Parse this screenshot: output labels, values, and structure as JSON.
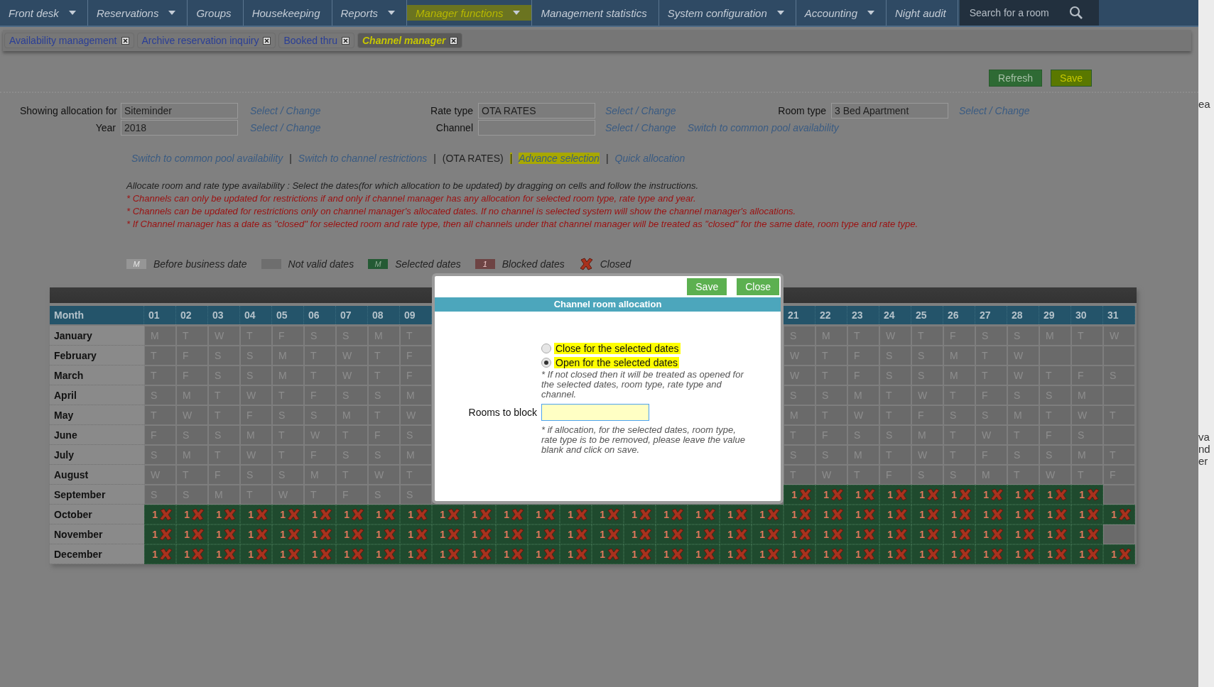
{
  "nav": {
    "items": [
      {
        "label": "Front desk",
        "dropdown": true,
        "highlighted": false
      },
      {
        "label": "Reservations",
        "dropdown": true,
        "highlighted": false
      },
      {
        "label": "Groups",
        "dropdown": false,
        "highlighted": false
      },
      {
        "label": "Housekeeping",
        "dropdown": false,
        "highlighted": false
      },
      {
        "label": "Reports",
        "dropdown": true,
        "highlighted": false
      },
      {
        "label": "Manager functions",
        "dropdown": true,
        "highlighted": true
      },
      {
        "label": "Management statistics",
        "dropdown": false,
        "highlighted": false
      },
      {
        "label": "System configuration",
        "dropdown": true,
        "highlighted": false
      },
      {
        "label": "Accounting",
        "dropdown": true,
        "highlighted": false
      },
      {
        "label": "Night audit",
        "dropdown": false,
        "highlighted": false
      }
    ],
    "search": {
      "placeholder": "Search for a room"
    }
  },
  "tabs": [
    {
      "label": "Availability management",
      "selected": false,
      "highlighted": false
    },
    {
      "label": "Archive reservation inquiry",
      "selected": false,
      "highlighted": false
    },
    {
      "label": "Booked thru",
      "selected": false,
      "highlighted": false
    },
    {
      "label": "Channel manager",
      "selected": true,
      "highlighted": true
    }
  ],
  "actions": [
    {
      "label": "Refresh",
      "highlighted": false
    },
    {
      "label": "Save",
      "highlighted": true
    }
  ],
  "filters": [
    {
      "label": "Showing allocation for",
      "value": "Siteminder",
      "link": "Select / Change"
    },
    {
      "label": "Rate type",
      "value": "OTA RATES",
      "link": "Select / Change"
    },
    {
      "label": "Room type",
      "value": "3 Bed Apartment",
      "link": "Select / Change"
    },
    {
      "label": "Year",
      "value": "2018",
      "link": "Select / Change"
    },
    {
      "label": "Channel",
      "link": "Select / Change",
      "extra_link": "Switch to common pool availability"
    }
  ],
  "links": [
    {
      "kind": "link",
      "text": "Switch to common pool availability",
      "highlighted": false
    },
    {
      "kind": "separator",
      "text": "|",
      "highlighted": false
    },
    {
      "kind": "link",
      "text": "Switch to channel restrictions",
      "highlighted": false
    },
    {
      "kind": "separator",
      "text": "|",
      "highlighted": false
    },
    {
      "kind": "text",
      "text": "(OTA RATES)",
      "highlighted": false
    },
    {
      "kind": "separator",
      "text": "|",
      "highlighted": true
    },
    {
      "kind": "link",
      "text": "Advance selection",
      "highlighted": true
    },
    {
      "kind": "separator",
      "text": "|",
      "highlighted": false
    },
    {
      "kind": "link",
      "text": "Quick allocation",
      "highlighted": false
    }
  ],
  "instructions": [
    {
      "kind": "info",
      "text": "Allocate room and rate type availability : Select the dates(for which allocation to be updated) by dragging on cells and follow the instructions."
    },
    {
      "kind": "warning",
      "text": "* Channels can only be updated for restrictions if and only if channel manager has any allocation for selected room type, rate type and year."
    },
    {
      "kind": "warning",
      "text": "* Channels can be updated for restrictions only on channel manager's allocated dates. If no channel is selected system will show the channel manager's allocations."
    },
    {
      "kind": "warning",
      "text": "* If Channel manager has a date as \"closed\" for selected room and rate type, then all channels under that channel manager will be treated as \"closed\" for the same date, room type and rate type."
    }
  ],
  "legend": [
    {
      "kind": "before",
      "swatch": "M",
      "label": "Before business date"
    },
    {
      "kind": "invalid",
      "label": "Not valid dates"
    },
    {
      "kind": "selected",
      "swatch": "M",
      "label": "Selected dates"
    },
    {
      "kind": "blocked",
      "swatch": "1",
      "label": "Blocked dates"
    },
    {
      "kind": "closed",
      "label": "Closed"
    }
  ],
  "calendar": {
    "month_header": "Month",
    "days_start": [
      "01",
      "02",
      "03",
      "04",
      "05",
      "06",
      "07",
      "08",
      "09"
    ],
    "days_end": [
      "21",
      "22",
      "23",
      "24",
      "25",
      "26",
      "27",
      "28",
      "29",
      "30",
      "31"
    ],
    "months": [
      {
        "name": "January",
        "cells_start": [
          "M",
          "T",
          "W",
          "T",
          "F",
          "S",
          "S",
          "M",
          "T"
        ],
        "cells_end": [
          "S",
          "M",
          "T",
          "W",
          "T",
          "F",
          "S",
          "S",
          "M",
          "T",
          "W"
        ]
      },
      {
        "name": "February",
        "cells_start": [
          "T",
          "F",
          "S",
          "S",
          "M",
          "T",
          "W",
          "T",
          "F"
        ],
        "cells_end": [
          "W",
          "T",
          "F",
          "S",
          "S",
          "M",
          "T",
          "W"
        ]
      },
      {
        "name": "March",
        "cells_start": [
          "T",
          "F",
          "S",
          "S",
          "M",
          "T",
          "W",
          "T",
          "F"
        ],
        "cells_end": [
          "W",
          "T",
          "F",
          "S",
          "S",
          "M",
          "T",
          "W",
          "T",
          "F",
          "S"
        ]
      },
      {
        "name": "April",
        "cells_start": [
          "S",
          "M",
          "T",
          "W",
          "T",
          "F",
          "S",
          "S",
          "M"
        ],
        "cells_end": [
          "S",
          "S",
          "M",
          "T",
          "W",
          "T",
          "F",
          "S",
          "S",
          "M"
        ]
      },
      {
        "name": "May",
        "cells_start": [
          "T",
          "W",
          "T",
          "F",
          "S",
          "S",
          "M",
          "T",
          "W"
        ],
        "cells_end": [
          "M",
          "T",
          "W",
          "T",
          "F",
          "S",
          "S",
          "M",
          "T",
          "W",
          "T"
        ]
      },
      {
        "name": "June",
        "cells_start": [
          "F",
          "S",
          "S",
          "M",
          "T",
          "W",
          "T",
          "F",
          "S"
        ],
        "cells_end": [
          "T",
          "F",
          "S",
          "S",
          "M",
          "T",
          "W",
          "T",
          "F",
          "S"
        ]
      },
      {
        "name": "July",
        "cells_start": [
          "S",
          "M",
          "T",
          "W",
          "T",
          "F",
          "S",
          "S",
          "M"
        ],
        "cells_end": [
          "S",
          "S",
          "M",
          "T",
          "W",
          "T",
          "F",
          "S",
          "S",
          "M",
          "T"
        ]
      },
      {
        "name": "August",
        "cells_start": [
          "W",
          "T",
          "F",
          "S",
          "S",
          "M",
          "T",
          "W",
          "T"
        ],
        "cells_end": [
          "T",
          "W",
          "T",
          "F",
          "S",
          "S",
          "M",
          "T",
          "W",
          "T",
          "F"
        ]
      },
      {
        "name": "September",
        "cells_start": [
          "S",
          "S",
          "M",
          "T",
          "W",
          "T",
          "F",
          "S",
          "S"
        ],
        "cells_end": [
          {
            "kind": "closed",
            "text": "1"
          },
          {
            "kind": "closed",
            "text": "1"
          },
          {
            "kind": "closed",
            "text": "1"
          },
          {
            "kind": "closed",
            "text": "1"
          },
          {
            "kind": "closed",
            "text": "1"
          },
          {
            "kind": "closed",
            "text": "1"
          },
          {
            "kind": "closed",
            "text": "1"
          },
          {
            "kind": "closed",
            "text": "1"
          },
          {
            "kind": "closed",
            "text": "1"
          },
          {
            "kind": "closed",
            "text": "1"
          }
        ]
      },
      {
        "name": "October",
        "cells": [
          {
            "kind": "closed",
            "text": "1"
          },
          {
            "kind": "closed",
            "text": "1"
          },
          {
            "kind": "closed",
            "text": "1"
          },
          {
            "kind": "closed",
            "text": "1"
          },
          {
            "kind": "closed",
            "text": "1"
          },
          {
            "kind": "closed",
            "text": "1"
          },
          {
            "kind": "closed",
            "text": "1"
          },
          {
            "kind": "closed",
            "text": "1"
          },
          {
            "kind": "closed",
            "text": "1"
          },
          {
            "kind": "closed",
            "text": "1"
          },
          {
            "kind": "closed",
            "text": "1"
          },
          {
            "kind": "closed",
            "text": "1"
          },
          {
            "kind": "closed",
            "text": "1"
          },
          {
            "kind": "closed",
            "text": "1"
          },
          {
            "kind": "closed",
            "text": "1"
          },
          {
            "kind": "closed",
            "text": "1"
          },
          {
            "kind": "closed",
            "text": "1"
          },
          {
            "kind": "closed",
            "text": "1"
          },
          {
            "kind": "closed",
            "text": "1"
          },
          {
            "kind": "closed",
            "text": "1"
          },
          {
            "kind": "closed",
            "text": "1"
          },
          {
            "kind": "closed",
            "text": "1"
          },
          {
            "kind": "closed",
            "text": "1"
          },
          {
            "kind": "closed",
            "text": "1"
          },
          {
            "kind": "closed",
            "text": "1"
          },
          {
            "kind": "closed",
            "text": "1"
          },
          {
            "kind": "closed",
            "text": "1"
          },
          {
            "kind": "closed",
            "text": "1"
          },
          {
            "kind": "closed",
            "text": "1"
          },
          {
            "kind": "closed",
            "text": "1"
          },
          {
            "kind": "closed",
            "text": "1"
          }
        ]
      },
      {
        "name": "November",
        "cells": [
          {
            "kind": "closed",
            "text": "1"
          },
          {
            "kind": "closed",
            "text": "1"
          },
          {
            "kind": "closed",
            "text": "1"
          },
          {
            "kind": "closed",
            "text": "1"
          },
          {
            "kind": "closed",
            "text": "1"
          },
          {
            "kind": "closed",
            "text": "1"
          },
          {
            "kind": "closed",
            "text": "1"
          },
          {
            "kind": "closed",
            "text": "1"
          },
          {
            "kind": "closed",
            "text": "1"
          },
          {
            "kind": "closed",
            "text": "1"
          },
          {
            "kind": "closed",
            "text": "1"
          },
          {
            "kind": "closed",
            "text": "1"
          },
          {
            "kind": "closed",
            "text": "1"
          },
          {
            "kind": "closed",
            "text": "1"
          },
          {
            "kind": "closed",
            "text": "1"
          },
          {
            "kind": "closed",
            "text": "1"
          },
          {
            "kind": "closed",
            "text": "1"
          },
          {
            "kind": "closed",
            "text": "1"
          },
          {
            "kind": "closed",
            "text": "1"
          },
          {
            "kind": "closed",
            "text": "1"
          },
          {
            "kind": "closed",
            "text": "1"
          },
          {
            "kind": "closed",
            "text": "1"
          },
          {
            "kind": "closed",
            "text": "1"
          },
          {
            "kind": "closed",
            "text": "1"
          },
          {
            "kind": "closed",
            "text": "1"
          },
          {
            "kind": "closed",
            "text": "1"
          },
          {
            "kind": "closed",
            "text": "1"
          },
          {
            "kind": "closed",
            "text": "1"
          },
          {
            "kind": "closed",
            "text": "1"
          },
          {
            "kind": "closed",
            "text": "1"
          }
        ]
      },
      {
        "name": "December",
        "cells": [
          {
            "kind": "closed",
            "text": "1"
          },
          {
            "kind": "closed",
            "text": "1"
          },
          {
            "kind": "closed",
            "text": "1"
          },
          {
            "kind": "closed",
            "text": "1"
          },
          {
            "kind": "closed",
            "text": "1"
          },
          {
            "kind": "closed",
            "text": "1"
          },
          {
            "kind": "closed",
            "text": "1"
          },
          {
            "kind": "closed",
            "text": "1"
          },
          {
            "kind": "closed",
            "text": "1"
          },
          {
            "kind": "closed",
            "text": "1"
          },
          {
            "kind": "closed",
            "text": "1"
          },
          {
            "kind": "closed",
            "text": "1"
          },
          {
            "kind": "closed",
            "text": "1"
          },
          {
            "kind": "closed",
            "text": "1"
          },
          {
            "kind": "closed",
            "text": "1"
          },
          {
            "kind": "closed",
            "text": "1"
          },
          {
            "kind": "closed",
            "text": "1"
          },
          {
            "kind": "closed",
            "text": "1"
          },
          {
            "kind": "closed",
            "text": "1"
          },
          {
            "kind": "closed",
            "text": "1"
          },
          {
            "kind": "closed",
            "text": "1"
          },
          {
            "kind": "closed",
            "text": "1"
          },
          {
            "kind": "closed",
            "text": "1"
          },
          {
            "kind": "closed",
            "text": "1"
          },
          {
            "kind": "closed",
            "text": "1"
          },
          {
            "kind": "closed",
            "text": "1"
          },
          {
            "kind": "closed",
            "text": "1"
          },
          {
            "kind": "closed",
            "text": "1"
          },
          {
            "kind": "closed",
            "text": "1"
          },
          {
            "kind": "closed",
            "text": "1"
          },
          {
            "kind": "closed",
            "text": "1"
          }
        ]
      }
    ]
  },
  "dialog": {
    "buttons": [
      "Save",
      "Close"
    ],
    "title": "Channel room allocation",
    "options": [
      {
        "label": "Close for the selected dates",
        "selected": false,
        "highlighted": true
      },
      {
        "label": "Open for the selected dates",
        "selected": true,
        "highlighted": true
      }
    ],
    "option_note": "* If not closed then it will be treated as opened for the selected dates, room type, rate type and channel.",
    "rooms_label": "Rooms to block",
    "rooms_note": "* if allocation, for the selected dates, room type, rate type is to be removed, please leave the value blank and click on save."
  },
  "side_fragments": [
    "ea",
    "va",
    "nd",
    "er"
  ]
}
